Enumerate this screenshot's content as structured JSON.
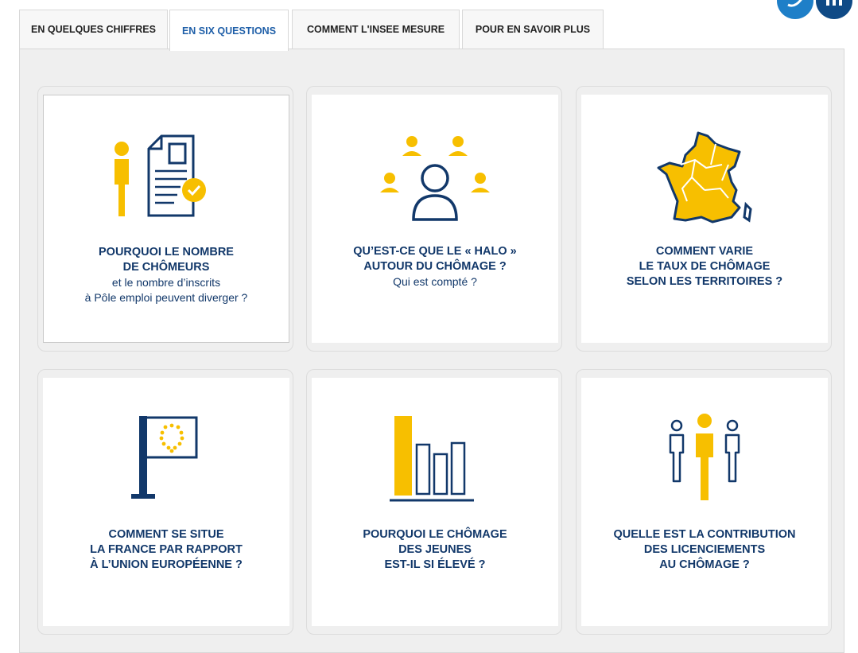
{
  "tabs": [
    {
      "label": "EN QUELQUES CHIFFRES",
      "active": false
    },
    {
      "label": "EN SIX QUESTIONS",
      "active": true
    },
    {
      "label": "COMMENT L'INSEE MESURE",
      "active": false
    },
    {
      "label": "POUR EN SAVOIR PLUS",
      "active": false
    }
  ],
  "social": [
    {
      "icon": "twitter-icon",
      "color": "#1e7fc8"
    },
    {
      "icon": "linkedin-icon",
      "color": "#0f4a86"
    }
  ],
  "colors": {
    "accent": "#f7bf00",
    "navy": "#12386a"
  },
  "cards": [
    {
      "icon": "person-document-icon",
      "bold": [
        "POURQUOI LE NOMBRE",
        "DE CHÔMEURS"
      ],
      "normal": [
        "et le nombre d’inscrits",
        "à Pôle emploi peuvent diverger ?"
      ]
    },
    {
      "icon": "halo-people-icon",
      "bold": [
        "QU’EST-CE QUE LE « HALO »",
        "AUTOUR DU CHÔMAGE ?"
      ],
      "normal": [
        "Qui est compté ?"
      ]
    },
    {
      "icon": "france-map-icon",
      "bold": [
        "COMMENT VARIE",
        "LE TAUX DE CHÔMAGE",
        "SELON LES TERRITOIRES ?"
      ],
      "normal": []
    },
    {
      "icon": "eu-flag-icon",
      "bold": [
        "COMMENT SE SITUE",
        "LA FRANCE PAR RAPPORT",
        "À L’UNION EUROPÉENNE ?"
      ],
      "normal": []
    },
    {
      "icon": "bar-chart-icon",
      "bold": [
        "POURQUOI LE CHÔMAGE",
        "DES JEUNES",
        "EST-IL SI ÉLEVÉ ?"
      ],
      "normal": []
    },
    {
      "icon": "three-people-icon",
      "bold": [
        "QUELLE EST LA CONTRIBUTION",
        "DES LICENCIEMENTS",
        "AU CHÔMAGE ?"
      ],
      "normal": []
    }
  ]
}
